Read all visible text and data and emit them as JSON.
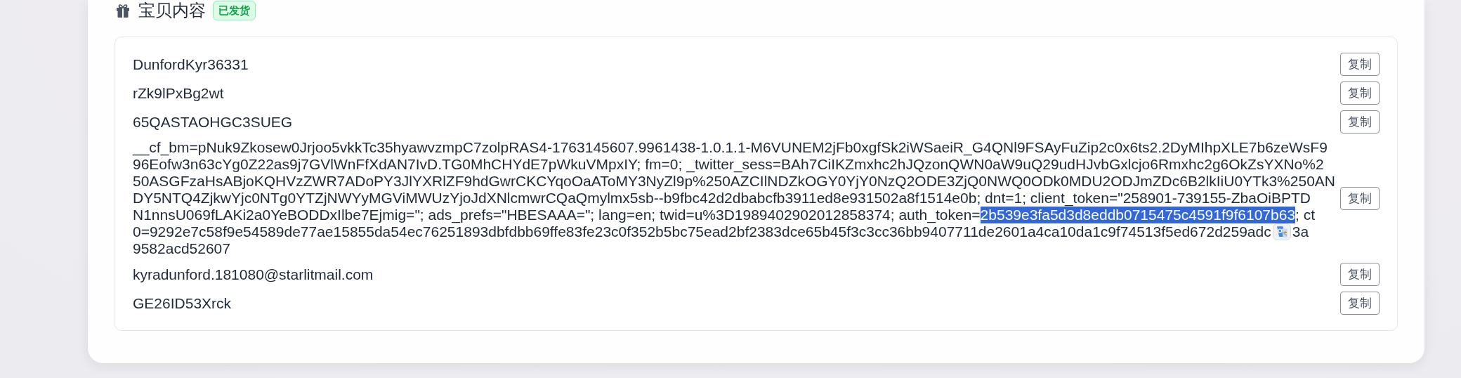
{
  "section": {
    "title": "宝贝内容",
    "badge": "已发货"
  },
  "items": [
    {
      "kind": "line",
      "text": "DunfordKyr36331",
      "button": "复制"
    },
    {
      "kind": "line",
      "text": "rZk9lPxBg2wt",
      "button": "复制"
    },
    {
      "kind": "line",
      "text": "65QASTAOHGC3SUEG",
      "button": "复制"
    },
    {
      "kind": "block",
      "button": "复制",
      "lines": [
        [
          {
            "text": "__cf_bm=pNuk9Zkosew0Jrjoo5vkkTc35hyawvzmpC7zolpRAS4-1763145607.9961438-1.0.1.1-M6VUNEM2jFb0xgfSk2iWSaeiR_G4QNl9FSAyFuZip2c0x6ts2.2DyMIhpXLE7b6zeWsF9",
            "selected": false
          }
        ],
        [
          {
            "text": "96Eofw3n63cYg0Z22as9j7GVlWnFfXdAN7IvD.TG0MhCHYdE7pWkuVMpxIY; fm=0; _twitter_sess=BAh7CiIKZmxhc2hJQzonQWN0aW9uQ29udHJvbGxlcjo6Rmxhc2g6OkZsYXNo%2",
            "selected": false
          }
        ],
        [
          {
            "text": "50ASGFzaHsABjoKQHVzZWR7ADoPY3JlYXRlZF9hdGwrCKCYqoOaAToMY3NyZl9p%250AZCIlNDZkOGY0YjY0NzQ2ODE3ZjQ0NWQ0ODk0MDU2ODJmZDc6B2lkIiU0YTk3%250AN",
            "selected": false
          }
        ],
        [
          {
            "text": "DY5NTQ4ZjkwYjc0NTg0YTZjNWYyMGViMWUzYjoJdXNlcmwrCQaQmylmx5sb--b9fbc42d2dbabcfb3911ed8e931502a8f1514e0b; dnt=1; client_token=\"258901-739155-ZbaOiBPTD",
            "selected": false
          }
        ],
        [
          {
            "text": "N1nnsU069fLAKi2a0YeBODDxIlbe7Ejmig=\"; ads_prefs=\"HBESAAA=\"; lang=en; twid=u%3D1989402902012858374; auth_token=",
            "selected": false
          },
          {
            "text": "2b539e3fa5d3d8eddb0715475c4591f9f6107b63",
            "selected": true
          },
          {
            "text": "; ct",
            "selected": false
          }
        ],
        [
          {
            "text": "0=9292e7c58f9e54589de77ae15855da54ec76251893dbfdbb69ffe83fe23c0f352b5bc75ead2bf2383dce65b45f3c3cc36bb9407711de2601a4ca10da1c9f74513f5ed672d259adc",
            "selected": false
          },
          {
            "kind": "translate"
          },
          {
            "text": "3a",
            "selected": false
          }
        ],
        [
          {
            "text": "9582acd52607",
            "selected": false
          }
        ]
      ]
    },
    {
      "kind": "line",
      "text": "kyradunford.181080@starlitmail.com",
      "button": "复制"
    },
    {
      "kind": "line",
      "text": "GE26ID53Xrck",
      "button": "复制"
    }
  ]
}
